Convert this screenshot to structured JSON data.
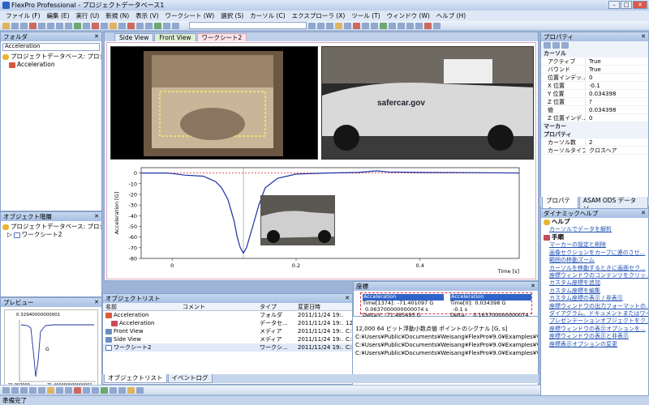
{
  "window": {
    "title": "FlexPro Professional - プロジェクトデータベース1"
  },
  "menu": [
    "ファイル (F)",
    "編集 (E)",
    "実行 (U)",
    "新規 (N)",
    "表示 (V)",
    "ワークシート (W)",
    "選択 (S)",
    "カーソル (C)",
    "エクスプローラ (X)",
    "ツール (T)",
    "ウィンドウ (W)",
    "ヘルプ (H)"
  ],
  "folder_panel": {
    "title": "フォルダ",
    "combo": "Acceleration",
    "items": [
      "プロジェクトデータベース: プロジェ",
      "Acceleration"
    ]
  },
  "hierarchy_panel": {
    "title": "オブジェクト階層",
    "items": [
      "プロジェクトデータベース: プロジ",
      "ワークシート2"
    ]
  },
  "preview_panel": {
    "title": "プレビュー",
    "top_value": "0.32940000000001",
    "axis_label": "G",
    "bottom_left": "-71.007000",
    "bottom_right": "71.400000000000001"
  },
  "doc_tabs": [
    "Side View",
    "Front View",
    "ワークシート2"
  ],
  "photo_label": "safercar.gov",
  "chart_data": {
    "type": "line",
    "ylabel": "Acceleration [G]",
    "xlabel": "Time [s]",
    "yticks": [
      "0",
      "-10",
      "-20",
      "-30",
      "-40",
      "-50",
      "-60",
      "-70",
      "-80"
    ],
    "xticks": [
      "0",
      "0.2",
      "0.4"
    ],
    "xlim": [
      -0.05,
      0.56
    ],
    "ylim": [
      -80,
      5
    ],
    "series": [
      {
        "values": [
          [
            -0.05,
            0
          ],
          [
            -0.01,
            0
          ],
          [
            0.0,
            -0.5
          ],
          [
            0.02,
            -2
          ],
          [
            0.05,
            -3
          ],
          [
            0.07,
            -8
          ],
          [
            0.08,
            -14
          ],
          [
            0.09,
            -25
          ],
          [
            0.1,
            -45
          ],
          [
            0.105,
            -60
          ],
          [
            0.11,
            -70
          ],
          [
            0.115,
            -75
          ],
          [
            0.12,
            -70
          ],
          [
            0.13,
            -50
          ],
          [
            0.14,
            -30
          ],
          [
            0.15,
            -14
          ],
          [
            0.17,
            -5
          ],
          [
            0.2,
            -1
          ],
          [
            0.25,
            0
          ],
          [
            0.3,
            0.5
          ],
          [
            0.33,
            2
          ],
          [
            0.35,
            1
          ],
          [
            0.4,
            0.5
          ],
          [
            0.5,
            0.3
          ],
          [
            0.56,
            0
          ]
        ]
      }
    ]
  },
  "object_list": {
    "title": "オブジェクトリスト",
    "headers": [
      "名前",
      "コメント",
      "タイプ",
      "変更日時",
      ""
    ],
    "rows": [
      {
        "name": "Acceleration",
        "comment": "",
        "type": "フォルダ",
        "date": "2011/11/24 19:...",
        "path": ""
      },
      {
        "name": "Acceleration",
        "comment": "",
        "type": "データセ...",
        "date": "2011/11/24 19:...",
        "path": "12,000 64 ビット浮動小数点値 ポイントのシグナル [G, s]"
      },
      {
        "name": "Front View",
        "comment": "",
        "type": "メディア",
        "date": "2011/11/24 19:...",
        "path": "C:¥Users¥Public¥Documents¥Weisang¥FlexPro¥9.0¥Examples¥Vid..."
      },
      {
        "name": "Side View",
        "comment": "",
        "type": "メディア",
        "date": "2011/11/24 19:...",
        "path": "C:¥Users¥Public¥Documents¥Weisang¥FlexPro¥9.0¥Examples¥Vid..."
      },
      {
        "name": "ワークシート2",
        "comment": "",
        "type": "ワークシ...",
        "date": "2011/11/24 19:...",
        "path": "C:¥Users¥Public¥Documents¥Weisang¥FlexPro¥9.0¥Examples¥Vid..."
      }
    ]
  },
  "bottom_tabs": [
    "オブジェクトリスト",
    "イベントログ"
  ],
  "coord_panel": {
    "title": "座標",
    "left": {
      "head": "Acceleration",
      "r1k": "Time[1374]:",
      "r1v": "-71.401097 G",
      "r2k": "",
      "r2v": "0.0637000000000074 s",
      "r3k": "Delta-Y:",
      "r3v": "-71.485495 G"
    },
    "right": {
      "head": "Acceleration",
      "r1k": "Time[0]:",
      "r1v": "0.034398 G",
      "r2k": "",
      "r2v": "-0.1 s",
      "r3k": "Delta-X:",
      "r3v": "0.163700000000074 s"
    }
  },
  "properties_panel": {
    "title": "プロパティ",
    "sections": [
      {
        "name": "カーソル",
        "rows": [
          [
            "アクティブ",
            "True"
          ],
          [
            "バウンド",
            "True"
          ],
          [
            "位置インデッ...",
            "0"
          ],
          [
            "X 位置",
            "-0.1"
          ],
          [
            "Y 位置",
            "0.034398"
          ],
          [
            "Z 位置",
            "?"
          ],
          [
            "値",
            "0.034398"
          ],
          [
            "Z 位置インデ...",
            "0"
          ]
        ]
      },
      {
        "name": "マーカー",
        "rows": []
      },
      {
        "name": "プロパティ",
        "rows": [
          [
            "カーソル数",
            "2"
          ],
          [
            "カーソルタイプ",
            "クロスヘア"
          ]
        ]
      }
    ],
    "tabs": [
      "プロパティ",
      "ASAM ODS データソ..."
    ]
  },
  "dynamic_help": {
    "title": "ダイナミックヘルプ",
    "help_head": "ヘルプ",
    "help_items": [
      "カーソルでデータを解析"
    ],
    "proc_head": "手順",
    "proc_items": [
      "マーカーの設定と削除",
      "画像セクションをカーブに連のさせ...",
      "範囲の移動ズーム",
      "カーソルを移動するときに画面セク...",
      "座標ウィンドウのコンテンツをクリッ...",
      "カスタム座標を追加",
      "カスタム座標を編集",
      "カスタム座標の表示 / 非表示",
      "座標ウィンドウの出力フォーマットの...",
      "ダイアグラム、ドキュメントまたはワー...",
      "プレゼンテーションオブジェクトをク...",
      "座標ウィンドウの表示オプションを...",
      "座標ウィンドウの表示と非表示",
      "座標表示オプションの変更"
    ]
  },
  "status": "準備完了"
}
